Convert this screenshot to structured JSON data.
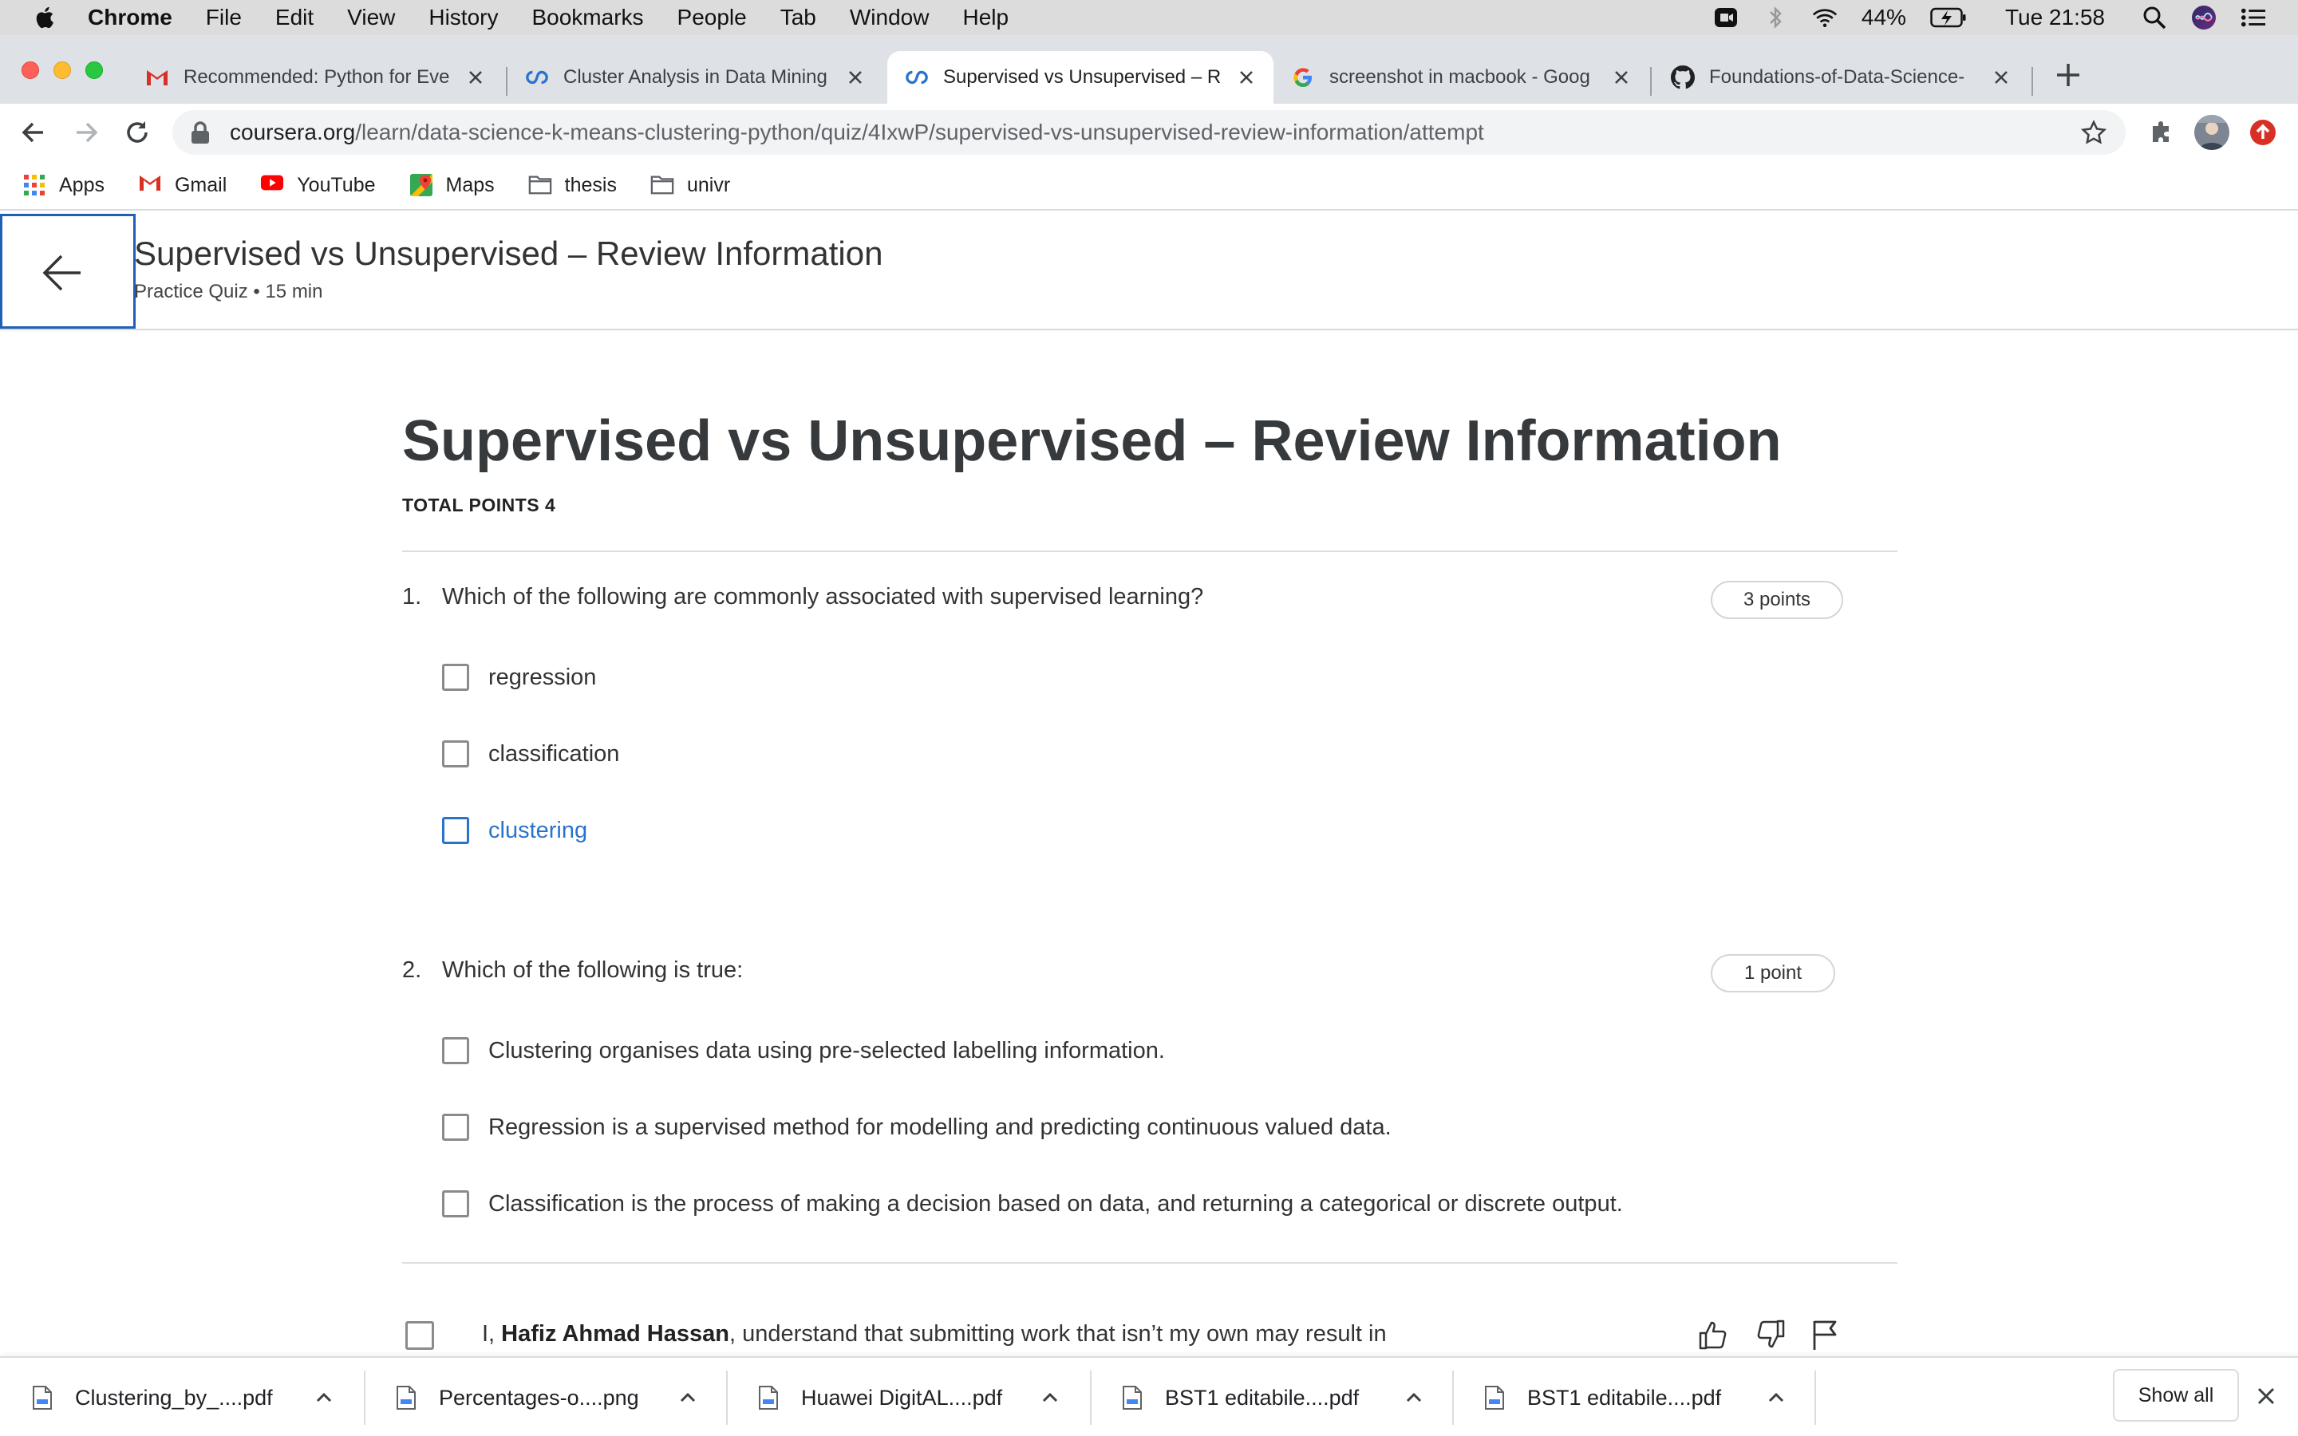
{
  "menubar": {
    "app_name": "Chrome",
    "items": [
      "File",
      "Edit",
      "View",
      "History",
      "Bookmarks",
      "People",
      "Tab",
      "Window",
      "Help"
    ],
    "battery": "44%",
    "clock": "Tue 21:58"
  },
  "tabs": [
    {
      "title": "Recommended: Python for Eve",
      "icon": "gmail-icon",
      "active": false
    },
    {
      "title": "Cluster Analysis in Data Mining",
      "icon": "coursera-icon",
      "active": false
    },
    {
      "title": "Supervised vs Unsupervised – R",
      "icon": "coursera-icon",
      "active": true
    },
    {
      "title": "screenshot in macbook - Goog",
      "icon": "google-icon",
      "active": false
    },
    {
      "title": "Foundations-of-Data-Science-",
      "icon": "github-icon",
      "active": false
    }
  ],
  "address_bar": {
    "host": "coursera.org",
    "path": "/learn/data-science-k-means-clustering-python/quiz/4IxwP/supervised-vs-unsupervised-review-information/attempt"
  },
  "bookmarks": [
    {
      "label": "Apps",
      "icon": "apps-grid-icon"
    },
    {
      "label": "Gmail",
      "icon": "gmail-icon"
    },
    {
      "label": "YouTube",
      "icon": "youtube-icon"
    },
    {
      "label": "Maps",
      "icon": "maps-icon"
    },
    {
      "label": "thesis",
      "icon": "folder-icon"
    },
    {
      "label": "univr",
      "icon": "folder-icon"
    }
  ],
  "header": {
    "title": "Supervised vs Unsupervised – Review Information",
    "subtitle": "Practice Quiz • 15 min"
  },
  "quiz": {
    "title": "Supervised vs Unsupervised – Review Information",
    "total_points": "TOTAL POINTS 4",
    "questions": [
      {
        "number": "1.",
        "text": "Which of the following are commonly associated with supervised learning?",
        "points": "3 points",
        "options": [
          "regression",
          "classification",
          "clustering"
        ]
      },
      {
        "number": "2.",
        "text": "Which of the following is true:",
        "points": "1 point",
        "options": [
          "Clustering organises data using pre-selected labelling information.",
          "Regression is a supervised method for modelling and predicting continuous valued data.",
          "Classification is the process of making a decision based on data, and returning a categorical or discrete output."
        ]
      }
    ],
    "honor": {
      "prefix": "I, ",
      "name": "Hafiz Ahmad Hassan",
      "suffix": ", understand that submitting work that isn’t my own may result in"
    }
  },
  "downloads": [
    {
      "name": "Clustering_by_....pdf"
    },
    {
      "name": "Percentages-o....png"
    },
    {
      "name": "Huawei DigitAL....pdf"
    },
    {
      "name": "BST1 editabile....pdf"
    },
    {
      "name": "BST1 editabile....pdf"
    }
  ],
  "downloads_show_all": "Show all",
  "colors": {
    "accent_blue": "#2a73cc",
    "back_button_border": "#1f5fb5",
    "tabstrip": "#dee1e6"
  }
}
